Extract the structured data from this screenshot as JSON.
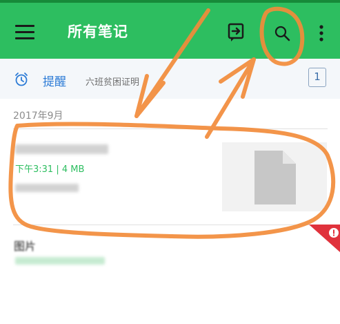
{
  "appbar": {
    "title": "所有笔记",
    "icons": [
      "menu-icon",
      "sync-icon",
      "search-icon",
      "more-vert-icon"
    ],
    "color": "#2dbe60"
  },
  "reminders": {
    "label": "提醒",
    "note": "六班贫困证明",
    "count": "1",
    "icon": "alarm-icon"
  },
  "notes": {
    "section_header": "2017年9月",
    "items": [
      {
        "meta": "下午3:31 | 4 MB",
        "thumbnail_icon": "file-icon"
      },
      {
        "title": "图片",
        "flag_icon": "alert-icon"
      }
    ]
  },
  "accent_colors": {
    "scribble": "#f28c3b",
    "flag": "#e0323c",
    "link": "#2c7bd6"
  }
}
